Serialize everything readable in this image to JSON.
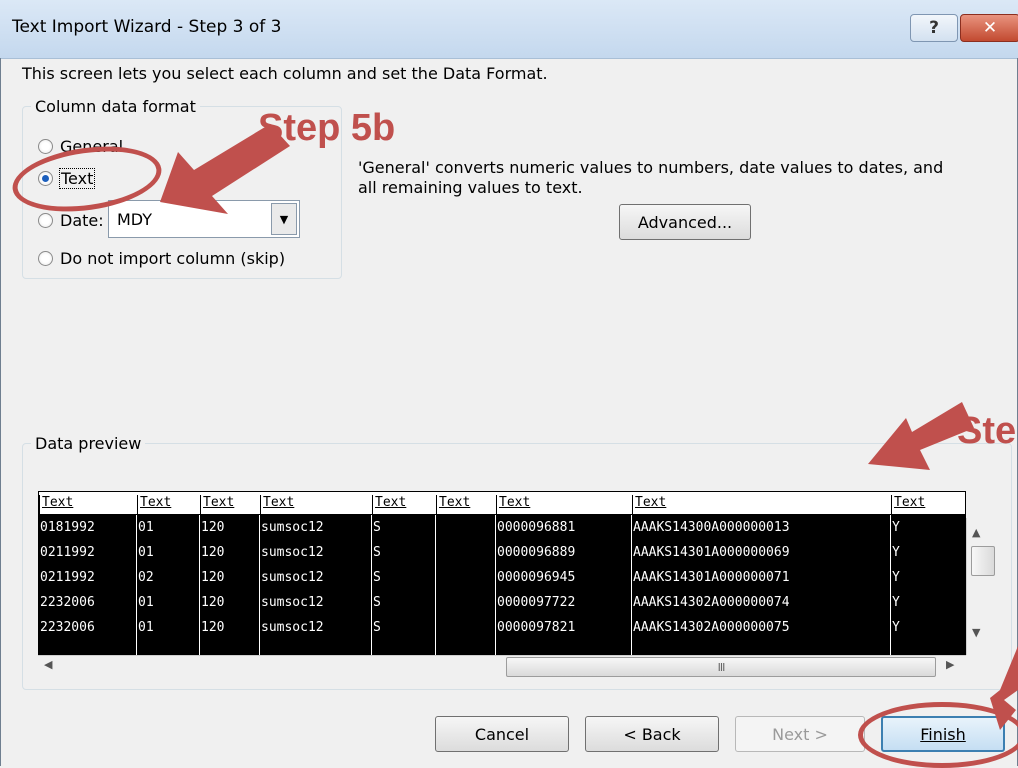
{
  "window": {
    "title": "Text Import Wizard - Step 3 of 3",
    "help_label": "?",
    "close_label": "✕"
  },
  "intro_text": "This screen lets you select each column and set the Data Format.",
  "column_data_format": {
    "legend": "Column data format",
    "options": {
      "general": {
        "label": "General",
        "checked": false
      },
      "text": {
        "label": "Text",
        "checked": true
      },
      "date": {
        "label": "Date:",
        "checked": false
      },
      "skip": {
        "label": "Do not import column (skip)",
        "checked": false
      }
    },
    "date_format_value": "MDY"
  },
  "description": {
    "line1": "'General' converts numeric values to numbers, date values to dates, and",
    "line2": "all remaining values to text."
  },
  "advanced_button": "Advanced...",
  "data_preview": {
    "legend": "Data preview",
    "columns": [
      "Text",
      "Text",
      "Text",
      "Text",
      "Text",
      "Text",
      "Text",
      "Text",
      "Text"
    ],
    "rows": [
      [
        "0181992",
        "01",
        "120",
        "sumsoc12",
        "S",
        "",
        "0000096881",
        "AAAKS14300A000000013",
        "Y"
      ],
      [
        "0211992",
        "01",
        "120",
        "sumsoc12",
        "S",
        "",
        "0000096889",
        "AAAKS14301A000000069",
        "Y"
      ],
      [
        "0211992",
        "02",
        "120",
        "sumsoc12",
        "S",
        "",
        "0000096945",
        "AAAKS14301A000000071",
        "Y"
      ],
      [
        "2232006",
        "01",
        "120",
        "sumsoc12",
        "S",
        "",
        "0000097722",
        "AAAKS14302A000000074",
        "Y"
      ],
      [
        "2232006",
        "01",
        "120",
        "sumsoc12",
        "S",
        "",
        "0000097821",
        "AAAKS14302A000000075",
        "Y"
      ]
    ],
    "hscroll_thumb_grip": "III"
  },
  "buttons": {
    "cancel": "Cancel",
    "back": "< Back",
    "next": "Next >",
    "finish": "Finish"
  },
  "annotations": {
    "step5b": "Step 5b",
    "step_right": "Ste",
    "color": "#c0504d"
  }
}
